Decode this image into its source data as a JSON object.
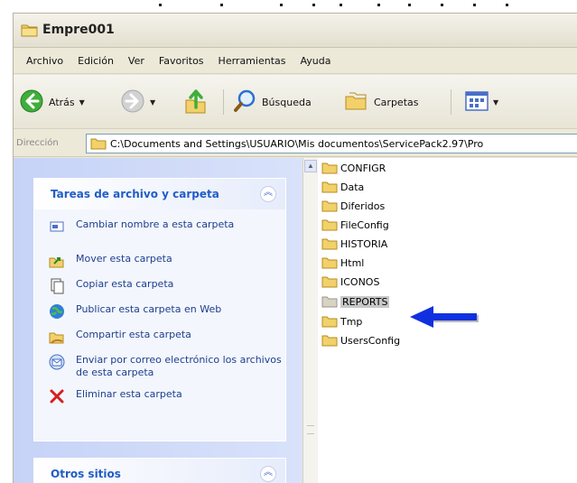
{
  "window": {
    "title": "Empre001"
  },
  "menu": {
    "items": [
      "Archivo",
      "Edición",
      "Ver",
      "Favoritos",
      "Herramientas",
      "Ayuda"
    ]
  },
  "toolbar": {
    "back_label": "Atrás",
    "search_label": "Búsqueda",
    "folders_label": "Carpetas"
  },
  "address": {
    "label": "Dirección",
    "path": "C:\\Documents and Settings\\USUARIO\\Mis documentos\\ServicePack2.97\\Pro"
  },
  "tasks_panel": {
    "title": "Tareas de archivo y carpeta",
    "items": [
      {
        "label": "Cambiar nombre a esta carpeta",
        "icon": "rename-icon"
      },
      {
        "label": "Mover esta carpeta",
        "icon": "move-icon"
      },
      {
        "label": "Copiar esta carpeta",
        "icon": "copy-icon"
      },
      {
        "label": "Publicar esta carpeta en Web",
        "icon": "publish-web-icon"
      },
      {
        "label": "Compartir esta carpeta",
        "icon": "share-icon"
      },
      {
        "label": "Enviar por correo electrónico los archivos de esta carpeta",
        "icon": "email-icon"
      },
      {
        "label": "Eliminar esta carpeta",
        "icon": "delete-icon"
      }
    ]
  },
  "other_panel": {
    "title": "Otros sitios"
  },
  "files": {
    "items": [
      "CONFIGR",
      "Data",
      "Diferidos",
      "FileConfig",
      "HISTORIA",
      "Html",
      "ICONOS",
      "REPORTS",
      "Tmp",
      "UsersConfig"
    ],
    "selected": "REPORTS"
  },
  "colors": {
    "title_text": "#222222",
    "task_link": "#1b3f8f",
    "panel_header": "#215dc6",
    "annotation_arrow": "#1030e0",
    "folder": "#f2d16b",
    "selection": "#c8c8c8"
  }
}
